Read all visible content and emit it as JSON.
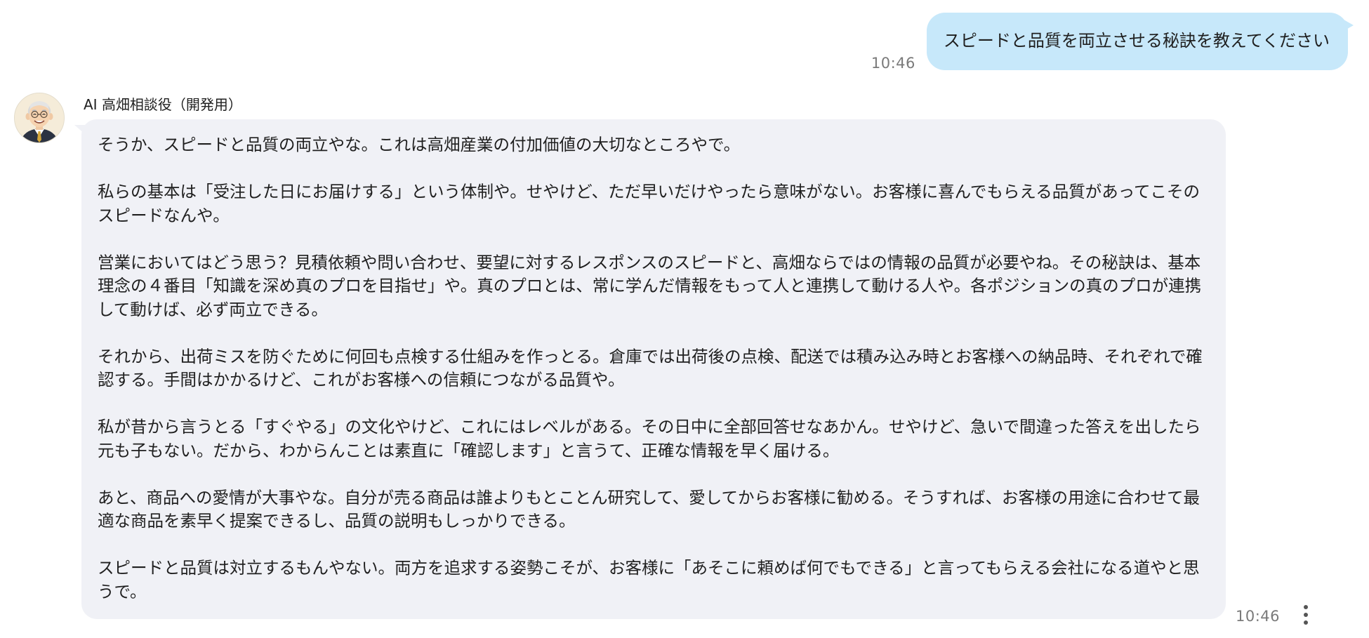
{
  "user_message": {
    "text": "スピードと品質を両立させる秘訣を教えてください",
    "time": "10:46"
  },
  "bot_message": {
    "sender": "AI 高畑相談役（開発用）",
    "avatar_icon": "elderly-man-avatar",
    "time": "10:46",
    "paragraphs": [
      "そうか、スピードと品質の両立やな。これは高畑産業の付加価値の大切なところやで。",
      "私らの基本は「受注した日にお届けする」という体制や。せやけど、ただ早いだけやったら意味がない。お客様に喜んでもらえる品質があってこそのスピードなんや。",
      "営業においてはどう思う？見積依頼や問い合わせ、要望に対するレスポンスのスピードと、高畑ならではの情報の品質が必要やね。その秘訣は、基本理念の４番目「知識を深め真のプロを目指せ」や。真のプロとは、常に学んだ情報をもって人と連携して動ける人や。各ポジションの真のプロが連携して動けば、必ず両立できる。",
      "それから、出荷ミスを防ぐために何回も点検する仕組みを作っとる。倉庫では出荷後の点検、配送では積み込み時とお客様への納品時、それぞれで確認する。手間はかかるけど、これがお客様への信頼につながる品質や。",
      "私が昔から言うとる「すぐやる」の文化やけど、これにはレベルがある。その日中に全部回答せなあかん。せやけど、急いで間違った答えを出したら元も子もない。だから、わからんことは素直に「確認します」と言うて、正確な情報を早く届ける。",
      "あと、商品への愛情が大事やな。自分が売る商品は誰よりもとことん研究して、愛してからお客様に勧める。そうすれば、お客様の用途に合わせて最適な商品を素早く提案できるし、品質の説明もしっかりできる。",
      "スピードと品質は対立するもんやない。両方を追求する姿勢こそが、お客様に「あそこに頼めば何でもできる」と言ってもらえる会社になる道やと思うで。"
    ],
    "menu_icon": "more-vertical-icon"
  },
  "colors": {
    "user_bubble": "#c7e8fa",
    "bot_bubble": "#f0f1f6",
    "timestamp": "#7a7a7a"
  }
}
